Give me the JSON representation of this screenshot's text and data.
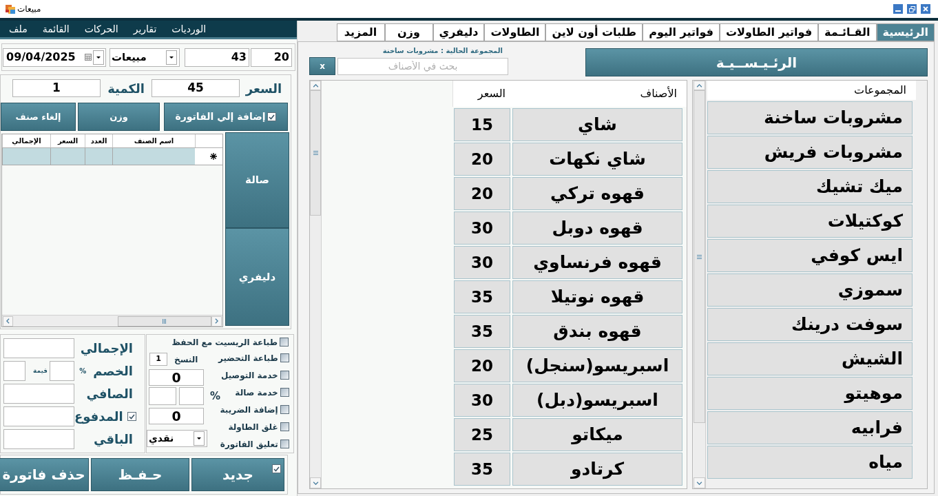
{
  "window": {
    "title": "مبيعات"
  },
  "menu": [
    "الورديات",
    "تقارير",
    "الحركات",
    "القائمة",
    "ملف"
  ],
  "invoice_header": {
    "date": "09/04/2025",
    "invoice_type": "مبيعات",
    "field_3": "43",
    "field_4": "20"
  },
  "item_entry": {
    "price_label": "السعر",
    "price": "45",
    "quantity_label": "الكمية",
    "quantity": "1"
  },
  "entry_buttons": [
    {
      "kind": "checkbox",
      "label": "إضافة إلي الفاتورة",
      "checked": true
    },
    {
      "kind": "plain",
      "label": "وزن"
    },
    {
      "kind": "plain",
      "label": "إلغاء صنف"
    }
  ],
  "invoice_table": {
    "columns": [
      "اسم الصنف",
      "العدد",
      "السعر",
      "الإجمالي"
    ]
  },
  "order_types": [
    "صالة",
    "دليفري"
  ],
  "totals": [
    {
      "kind": "field",
      "label": "الإجمالي"
    },
    {
      "kind": "discount",
      "label": "الخصم",
      "percent_sign": "%",
      "value_label": "قيمة"
    },
    {
      "kind": "field",
      "label": "الصافي"
    },
    {
      "kind": "checkbox",
      "label": "المدفوع",
      "checked": true
    },
    {
      "kind": "field",
      "label": "الباقي"
    }
  ],
  "options": [
    {
      "label": "طباعة الريسيت مع الحفظ",
      "checked": false
    },
    {
      "label": "طباعة التحضير",
      "checked": false
    },
    {
      "label": "خدمة التوصيل",
      "checked": false
    },
    {
      "label": "خدمة صالة",
      "checked": false
    },
    {
      "label": "إضافة الضريبة",
      "checked": false
    },
    {
      "label": "غلق الطاولة",
      "checked": false
    },
    {
      "label": "تعليق الفاتورة",
      "checked": false
    }
  ],
  "copies": {
    "label": "النسخ",
    "value": "1"
  },
  "charges": {
    "field_1": "0",
    "percent_sign": "%",
    "field_2": "0",
    "payment_method": "نقدي"
  },
  "actions": [
    {
      "kind": "checkbox",
      "label": "جديد",
      "checked": true
    },
    {
      "kind": "plain",
      "label": "حـفـظ"
    },
    {
      "kind": "plain",
      "label": "حذف فاتورة"
    }
  ],
  "tabs": [
    {
      "label": "الرئيسية",
      "selected": true
    },
    {
      "label": "القـائـمة",
      "selected": false
    },
    {
      "label": "فواتير الطاولات",
      "selected": false
    },
    {
      "label": "فواتير اليوم",
      "selected": false
    },
    {
      "label": "طلبات أون لاين",
      "selected": false
    },
    {
      "label": "الطاولات",
      "selected": false
    },
    {
      "label": "دليفري",
      "selected": false
    },
    {
      "label": "وزن",
      "selected": false
    },
    {
      "label": "المزيد",
      "selected": false
    }
  ],
  "home_button": "الرئـيـســيـة",
  "current_group": "المجموعة الحالية : مشروبات ساخنة",
  "search": {
    "placeholder": "بحث في الأصناف",
    "clear_button": "x"
  },
  "items_table": {
    "columns": [
      "الأصناف",
      "السعر"
    ],
    "rows": [
      {
        "name": "شاي",
        "price": "15"
      },
      {
        "name": "شاي نكهات",
        "price": "20"
      },
      {
        "name": "قهوه تركي",
        "price": "20"
      },
      {
        "name": "قهوه دوبل",
        "price": "30"
      },
      {
        "name": "قهوه فرنساوي",
        "price": "30"
      },
      {
        "name": "قهوه نوتيلا",
        "price": "35"
      },
      {
        "name": "قهوه بندق",
        "price": "35"
      },
      {
        "name": "اسبريسو(سنجل)",
        "price": "20"
      },
      {
        "name": "اسبريسو(دبل)",
        "price": "30"
      },
      {
        "name": "ميكاتو",
        "price": "25"
      },
      {
        "name": "كرتادو",
        "price": "35"
      }
    ]
  },
  "groups": {
    "header": "المجموعات",
    "items": [
      "مشروبات ساخنة",
      "مشروبات فريش",
      "ميك تشيك",
      "كوكتيلات",
      "ايس كوفي",
      "سموزي",
      "سوفت درينك",
      "الشيش",
      "موهيتو",
      "فرابيه",
      "مياه"
    ]
  }
}
